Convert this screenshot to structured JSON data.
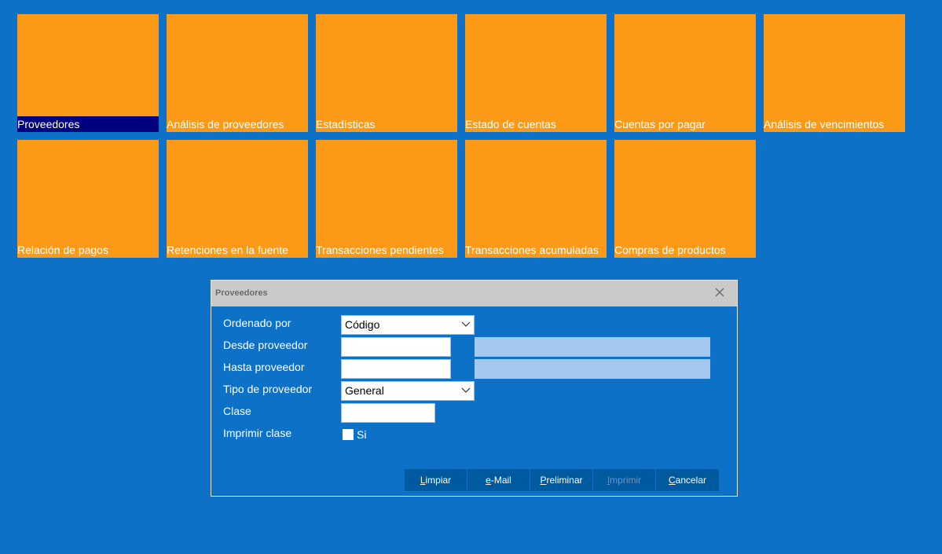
{
  "tiles": [
    {
      "label": "Proveedores",
      "selected": true
    },
    {
      "label": "Análisis de proveedores"
    },
    {
      "label": "Estadísticas"
    },
    {
      "label": "Estado de cuentas"
    },
    {
      "label": "Cuentas por pagar"
    },
    {
      "label": "Análisis de vencimientos"
    },
    {
      "label": "Relación de pagos"
    },
    {
      "label": "Retenciones en la fuente"
    },
    {
      "label": "Transacciones pendientes"
    },
    {
      "label": "Transacciones acumuladas"
    },
    {
      "label": "Compras de productos"
    }
  ],
  "dialog": {
    "title": "Proveedores",
    "labels": {
      "ordenado_por": "Ordenado por",
      "desde_proveedor": "Desde proveedor",
      "hasta_proveedor": "Hasta proveedor",
      "tipo_proveedor": "Tipo de proveedor",
      "clase": "Clase",
      "imprimir_clase": "Imprimir clase"
    },
    "values": {
      "ordenado_por": "Código",
      "desde_proveedor": "",
      "hasta_proveedor": "",
      "tipo_proveedor": "General",
      "clase": "",
      "imprimir_clase_checkbox_label": "Si",
      "imprimir_clase_checked": false
    },
    "buttons": {
      "limpiar": {
        "hotkey": "L",
        "rest": "impiar"
      },
      "email": {
        "hotkey": "e",
        "rest": "-Mail"
      },
      "preliminar": {
        "hotkey": "P",
        "rest": "reliminar"
      },
      "imprimir": {
        "hotkey": "I",
        "rest": "mprimir",
        "disabled": true
      },
      "cancelar": {
        "hotkey": "C",
        "rest": "ancelar"
      }
    }
  },
  "colors": {
    "background": "#0E71C8",
    "tile": "#FC9A17",
    "tile_selected_label_bg": "#00007F",
    "button": "#005AA0"
  }
}
